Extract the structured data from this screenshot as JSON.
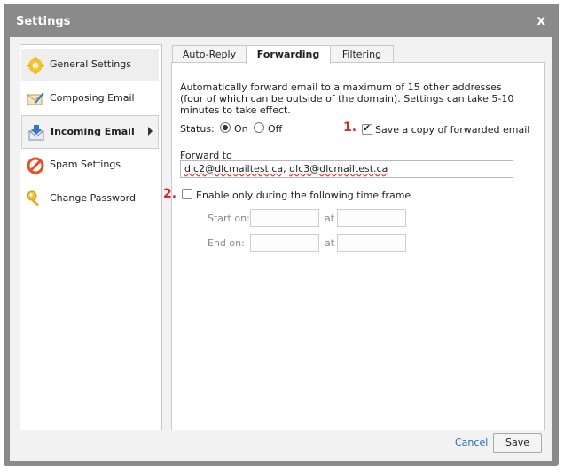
{
  "window": {
    "title": "Settings",
    "close_label": "x"
  },
  "sidebar": {
    "items": [
      {
        "label": "General Settings"
      },
      {
        "label": "Composing Email"
      },
      {
        "label": "Incoming Email"
      },
      {
        "label": "Spam Settings"
      },
      {
        "label": "Change Password"
      }
    ]
  },
  "tabs": [
    {
      "label": "Auto-Reply"
    },
    {
      "label": "Forwarding"
    },
    {
      "label": "Filtering"
    }
  ],
  "forwarding": {
    "description": "Automatically forward email to a maximum of 15 other addresses (four of which can be outside of the domain). Settings can take 5-10 minutes to take effect.",
    "status_label": "Status:",
    "on_label": "On",
    "off_label": "Off",
    "status_value": "On",
    "save_copy_label": "Save a copy of forwarded email",
    "save_copy_checked": true,
    "forward_to_label": "Forward to",
    "forward_to_addresses": [
      "dlc2@dlcmailtest.ca",
      "dlc3@dlcmailtest.ca"
    ],
    "forward_to_separator": ", ",
    "time_frame_label": "Enable only during the following time frame",
    "time_frame_checked": false,
    "start_on_label": "Start on:",
    "end_on_label": "End on:",
    "at_label": "at",
    "start_date": "",
    "start_time": "",
    "end_date": "",
    "end_time": ""
  },
  "annotations": {
    "marker_1": "1.",
    "marker_2": "2."
  },
  "footer": {
    "cancel_label": "Cancel",
    "save_label": "Save"
  },
  "colors": {
    "titlebar": "#8a8a8a",
    "link": "#1f6fb5",
    "marker": "#d9262b"
  }
}
